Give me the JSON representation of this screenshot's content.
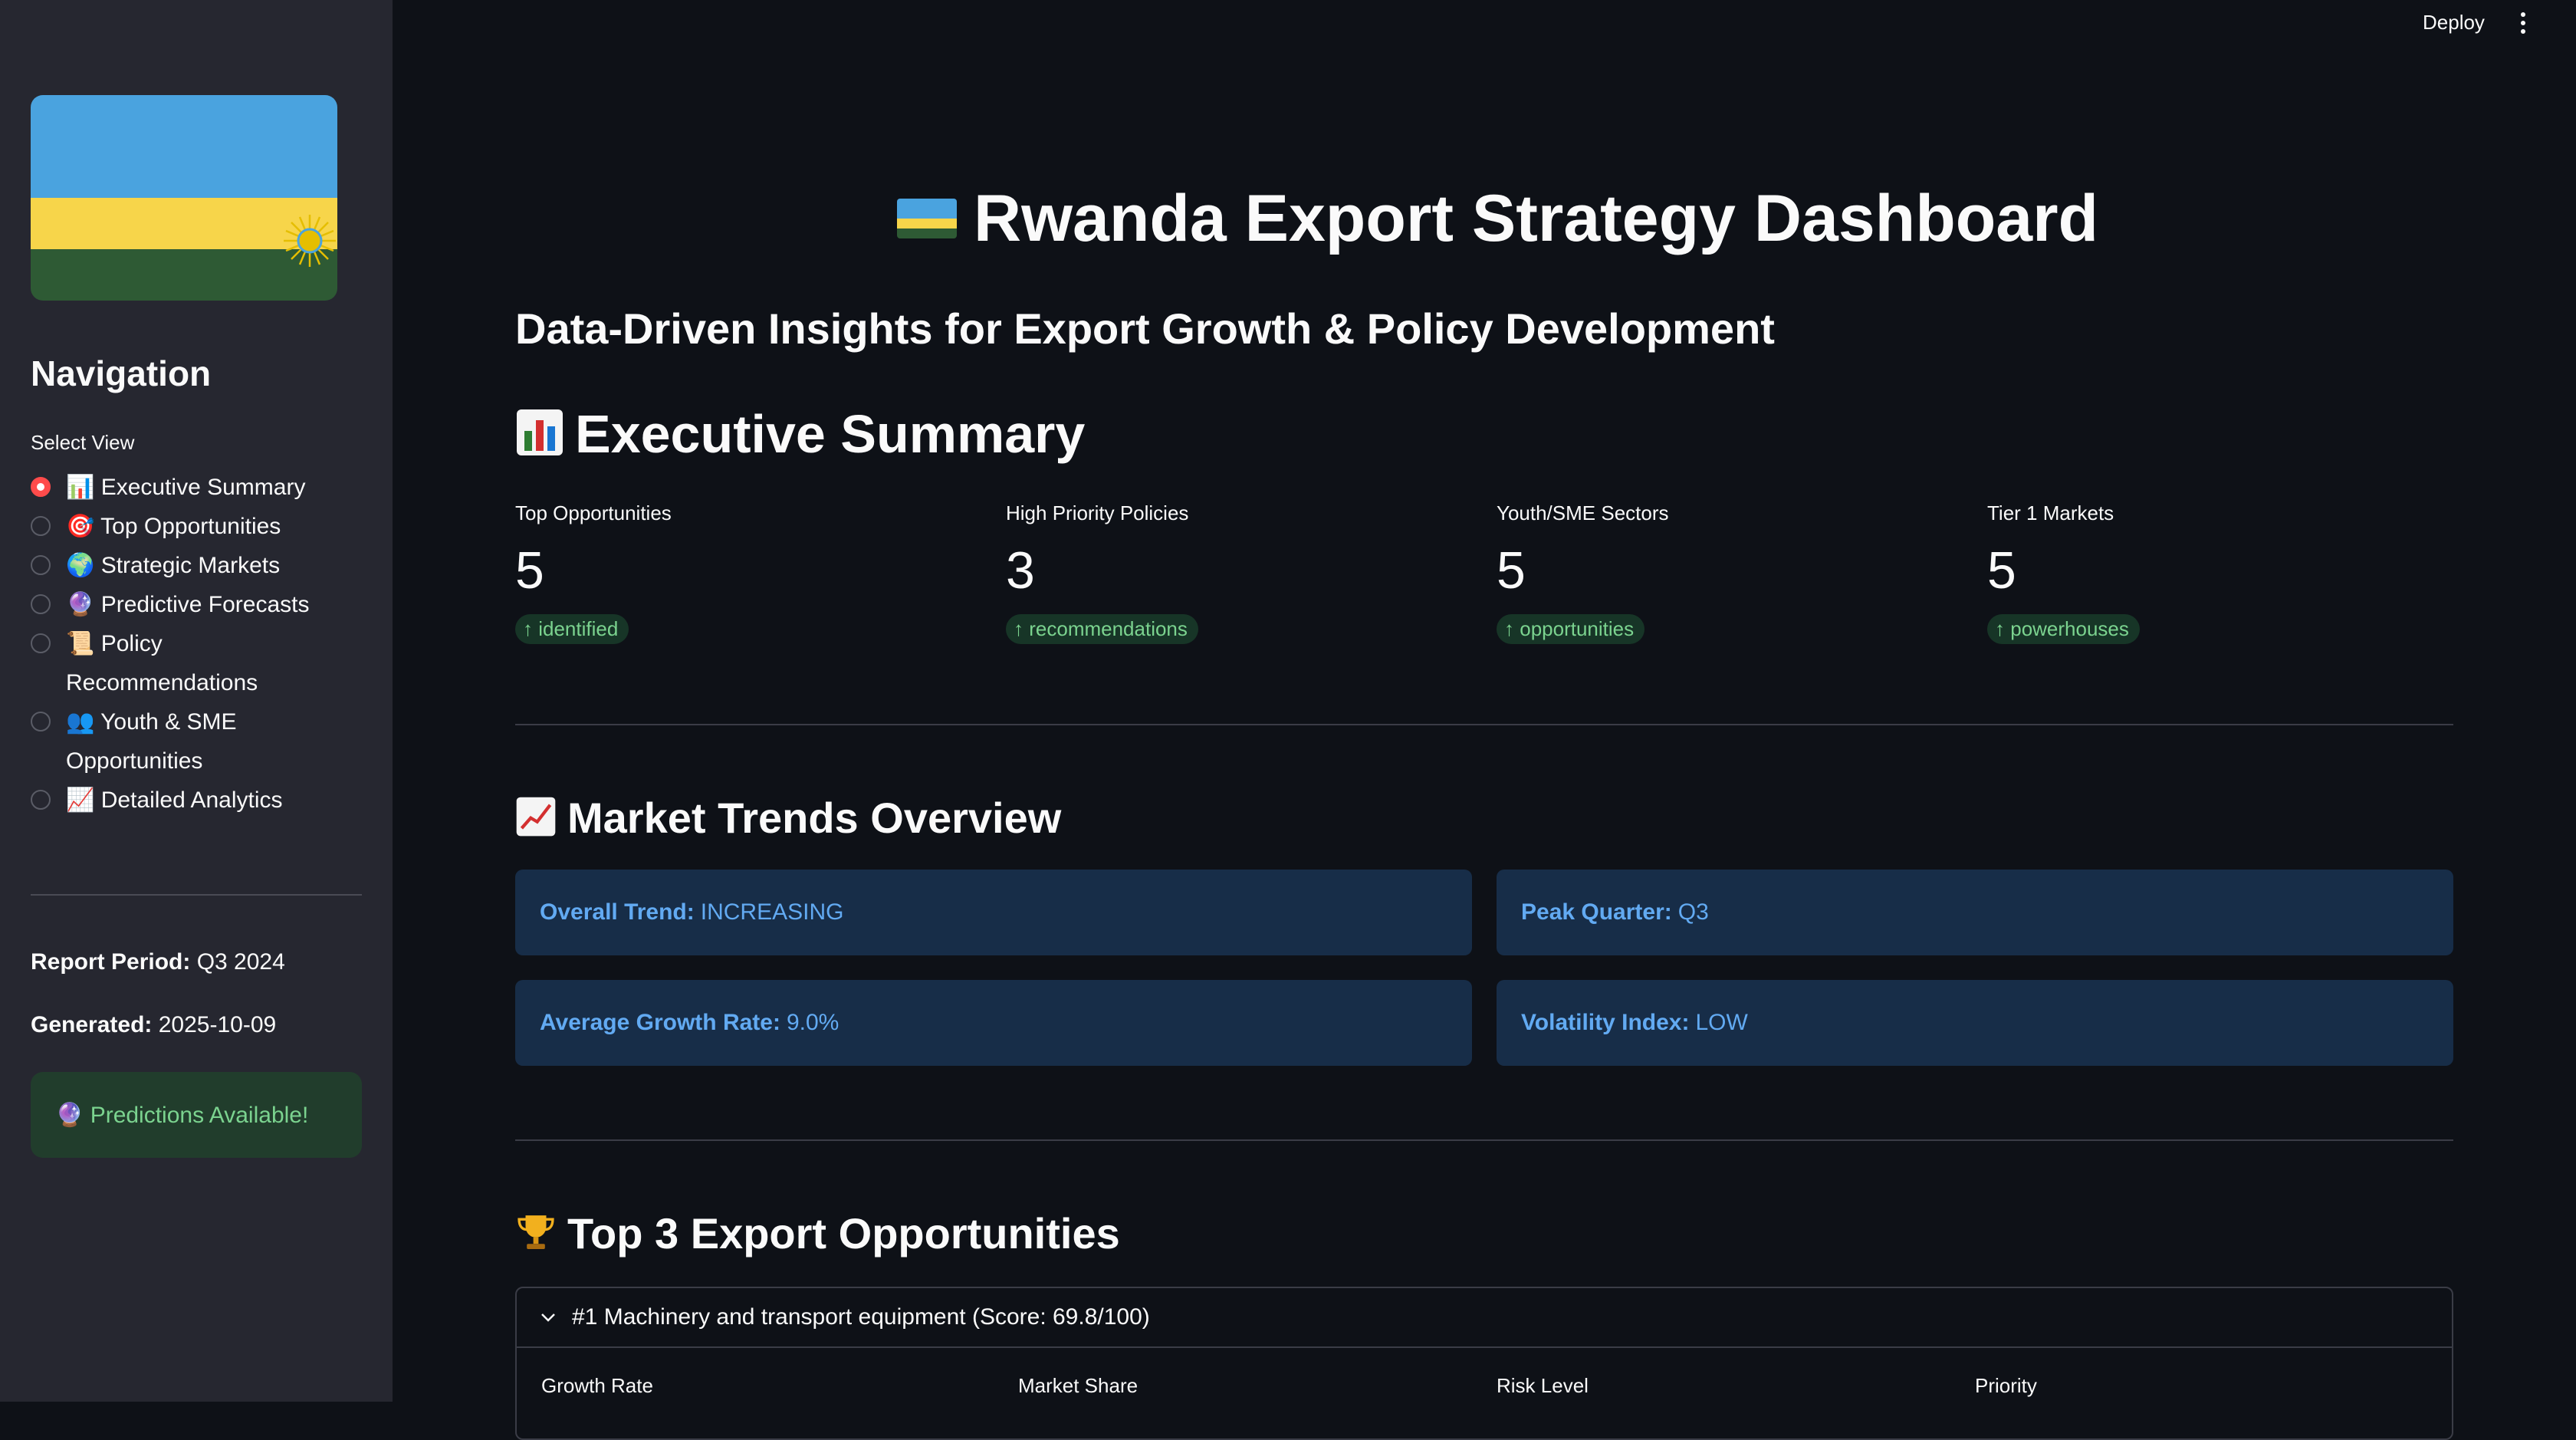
{
  "header": {
    "deploy_label": "Deploy"
  },
  "sidebar": {
    "navigation_title": "Navigation",
    "select_label": "Select View",
    "items": [
      {
        "icon": "📊",
        "label": "Executive Summary",
        "selected": true
      },
      {
        "icon": "🎯",
        "label": "Top Opportunities",
        "selected": false
      },
      {
        "icon": "🌍",
        "label": "Strategic Markets",
        "selected": false
      },
      {
        "icon": "🔮",
        "label": "Predictive Forecasts",
        "selected": false
      },
      {
        "icon": "📜",
        "label": "Policy Recommendations",
        "selected": false
      },
      {
        "icon": "👥",
        "label": "Youth & SME Opportunities",
        "selected": false
      },
      {
        "icon": "📈",
        "label": "Detailed Analytics",
        "selected": false
      }
    ],
    "report_period_label": "Report Period:",
    "report_period_value": "Q3 2024",
    "generated_label": "Generated:",
    "generated_value": "2025-10-09",
    "predictions_notice": "🔮 Predictions Available!"
  },
  "main": {
    "title": "Rwanda Export Strategy Dashboard",
    "subtitle": "Data-Driven Insights for Export Growth & Policy Development",
    "exec_summary_title": "Executive Summary",
    "metrics": [
      {
        "label": "Top Opportunities",
        "value": "5",
        "delta": "identified"
      },
      {
        "label": "High Priority Policies",
        "value": "3",
        "delta": "recommendations"
      },
      {
        "label": "Youth/SME Sectors",
        "value": "5",
        "delta": "opportunities"
      },
      {
        "label": "Tier 1 Markets",
        "value": "5",
        "delta": "powerhouses"
      }
    ],
    "trends_title": "Market Trends Overview",
    "trends": [
      {
        "label": "Overall Trend:",
        "value": "INCREASING"
      },
      {
        "label": "Peak Quarter:",
        "value": "Q3"
      },
      {
        "label": "Average Growth Rate:",
        "value": "9.0%"
      },
      {
        "label": "Volatility Index:",
        "value": "LOW"
      }
    ],
    "top3_title": "Top 3 Export Opportunities",
    "expander": {
      "title": "#1 Machinery and transport equipment (Score: 69.8/100)",
      "columns": [
        "Growth Rate",
        "Market Share",
        "Risk Level",
        "Priority"
      ]
    }
  },
  "colors": {
    "background": "#0e1117",
    "sidebar": "#262730",
    "accent_radio": "#ff4b4b",
    "info_bg": "#172d48",
    "info_text": "#62aaf2",
    "success_bg": "#213d2c",
    "success_text": "#7bd38f"
  }
}
